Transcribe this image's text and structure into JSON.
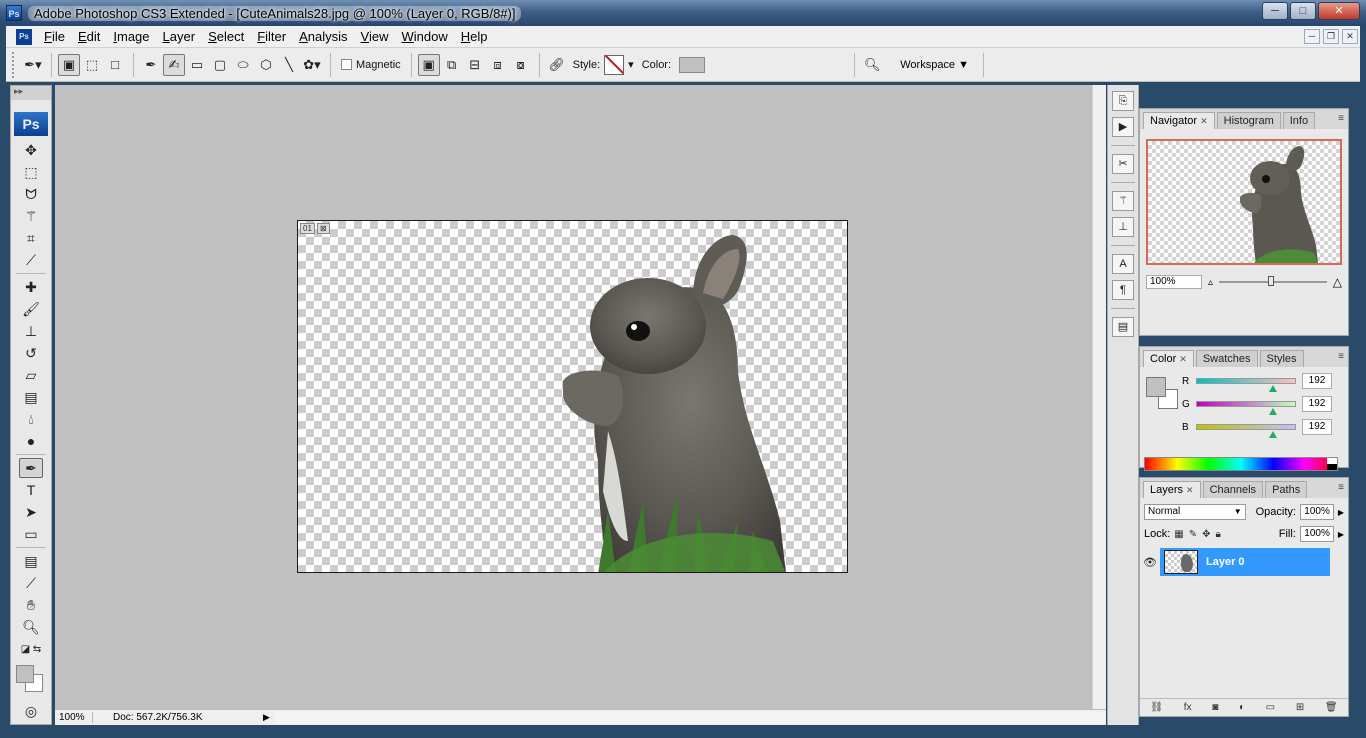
{
  "window": {
    "title": "Adobe Photoshop CS3 Extended - [CuteAnimals28.jpg @ 100% (Layer 0, RGB/8#)]",
    "app_icon": "Ps",
    "controls": {
      "minimize": "─",
      "maximize": "□",
      "close": "✕"
    }
  },
  "menu": {
    "app_icon": "Ps",
    "items": [
      "File",
      "Edit",
      "Image",
      "Layer",
      "Select",
      "Filter",
      "Analysis",
      "View",
      "Window",
      "Help"
    ],
    "doc_controls": {
      "minimize": "─",
      "restore": "❐",
      "close": "✕"
    }
  },
  "options": {
    "magnetic_label": "Magnetic",
    "style_label": "Style:",
    "color_label": "Color:",
    "color_value": "#c0c0c0",
    "workspace_label": "Workspace ▼"
  },
  "tools": {
    "logo": "Ps",
    "list": [
      "move-icon",
      "marquee-icon",
      "lasso-icon",
      "magic-wand-icon",
      "crop-icon",
      "slice-icon",
      "healing-brush-icon",
      "brush-icon",
      "clone-stamp-icon",
      "history-brush-icon",
      "eraser-icon",
      "gradient-icon",
      "blur-icon",
      "dodge-icon",
      "pen-icon",
      "type-icon",
      "path-selection-icon",
      "shape-icon",
      "notes-icon",
      "eyedropper-icon",
      "hand-icon",
      "zoom-icon"
    ],
    "foreground_color": "#c0c0c0",
    "background_color": "#ffffff"
  },
  "canvas": {
    "frame_badge": [
      "01",
      "⊠"
    ]
  },
  "status": {
    "zoom": "100%",
    "doc": "Doc: 567.2K/756.3K"
  },
  "panels": {
    "navigator": {
      "tabs": [
        "Navigator",
        "Histogram",
        "Info"
      ],
      "zoom": "100%"
    },
    "color": {
      "tabs": [
        "Color",
        "Swatches",
        "Styles"
      ],
      "channels": [
        {
          "label": "R",
          "value": "192"
        },
        {
          "label": "G",
          "value": "192"
        },
        {
          "label": "B",
          "value": "192"
        }
      ]
    },
    "layers": {
      "tabs": [
        "Layers",
        "Channels",
        "Paths"
      ],
      "blend_mode": "Normal",
      "opacity_label": "Opacity:",
      "opacity": "100%",
      "lock_label": "Lock:",
      "fill_label": "Fill:",
      "fill": "100%",
      "layer_name": "Layer 0",
      "selected_color": "#3399ff",
      "footer_icons": [
        "link-icon",
        "fx-icon",
        "mask-icon",
        "adjustment-icon",
        "group-icon",
        "new-layer-icon",
        "trash-icon"
      ]
    }
  }
}
